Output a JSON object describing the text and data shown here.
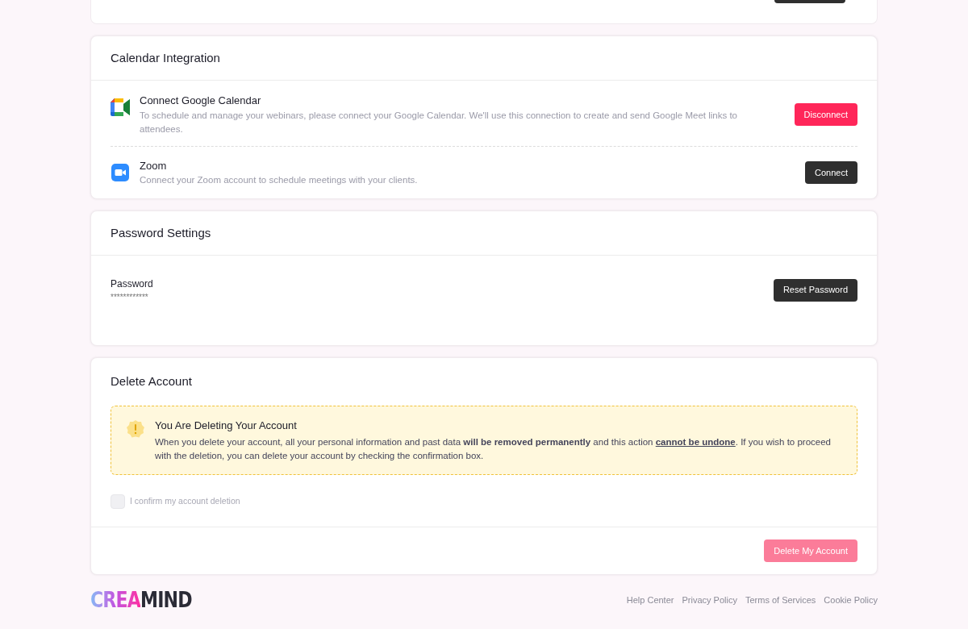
{
  "calendar": {
    "title": "Calendar Integration",
    "items": [
      {
        "kind": "google",
        "name": "Connect Google Calendar",
        "description": "To schedule and manage your webinars, please connect your Google Calendar. We'll use this connection to create and send Google Meet links to attendees.",
        "connected": true,
        "button": "Disconnect"
      },
      {
        "kind": "zoom",
        "name": "Zoom",
        "description": "Connect your Zoom account to schedule meetings with your clients.",
        "connected": false,
        "button": "Connect"
      }
    ]
  },
  "password": {
    "title": "Password Settings",
    "label": "Password",
    "value": "************",
    "button": "Reset Password"
  },
  "delete_account": {
    "title": "Delete Account",
    "warning_title": "You Are Deleting Your Account",
    "warning_text": [
      {
        "kind": "plain",
        "text": "When you delete your account, all your personal information and past data "
      },
      {
        "kind": "emphasis",
        "text": "will be removed permanently"
      },
      {
        "kind": "plain",
        "text": " and this action "
      },
      {
        "kind": "underlined",
        "text": "cannot be undone"
      },
      {
        "kind": "plain",
        "text": ". If you wish to proceed with the deletion, you can delete your account by checking the confirmation box."
      }
    ],
    "confirm_label": "I confirm my account deletion",
    "confirm_checked": false,
    "button": "Delete My Account",
    "button_disabled": true
  },
  "footer": {
    "logo": {
      "gradient_part": "CREA",
      "plain_part": "MIND"
    },
    "links": [
      "Help Center",
      "Privacy Policy",
      "Terms of Services",
      "Cookie Policy"
    ]
  }
}
